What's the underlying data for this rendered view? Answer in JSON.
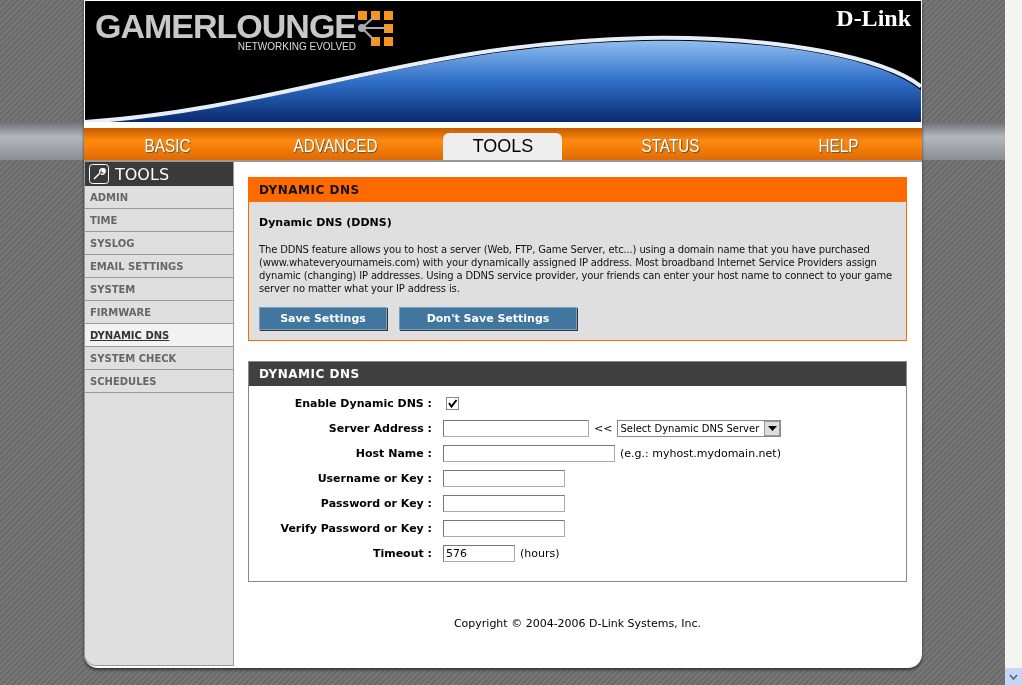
{
  "banner": {
    "logo_text": "GAMERLOUNGE",
    "logo_tagline": "NETWORKING EVOLVED",
    "brand": "D-Link"
  },
  "tabs": [
    {
      "label": "BASIC",
      "selected": false
    },
    {
      "label": "ADVANCED",
      "selected": false
    },
    {
      "label": "TOOLS",
      "selected": true
    },
    {
      "label": "STATUS",
      "selected": false
    },
    {
      "label": "HELP",
      "selected": false
    }
  ],
  "sidebar": {
    "title": "TOOLS",
    "items": [
      {
        "label": "ADMIN",
        "selected": false
      },
      {
        "label": "TIME",
        "selected": false
      },
      {
        "label": "SYSLOG",
        "selected": false
      },
      {
        "label": "EMAIL SETTINGS",
        "selected": false
      },
      {
        "label": "SYSTEM",
        "selected": false
      },
      {
        "label": "FIRMWARE",
        "selected": false
      },
      {
        "label": "DYNAMIC DNS",
        "selected": true
      },
      {
        "label": "SYSTEM CHECK",
        "selected": false
      },
      {
        "label": "SCHEDULES",
        "selected": false
      }
    ]
  },
  "intro": {
    "title": "DYNAMIC DNS",
    "subtitle": "Dynamic DNS (DDNS)",
    "text": "The DDNS feature allows you to host a server (Web, FTP, Game Server, etc...) using a domain name that you have purchased (www.whateveryournameis.com) with your dynamically assigned IP address. Most broadband Internet Service Providers assign dynamic (changing) IP addresses. Using a DDNS service provider, your friends can enter your host name to connect to your game server no matter what your IP address is.",
    "buttons": [
      "Save Settings",
      "Don't Save Settings"
    ]
  },
  "form": {
    "title": "DYNAMIC DNS",
    "rows": [
      {
        "kind": "checkbox",
        "label": "Enable Dynamic DNS :",
        "checked": true
      },
      {
        "kind": "server",
        "label": "Server Address :",
        "arrow": "<<",
        "select": "Select Dynamic DNS Server"
      },
      {
        "kind": "hinted",
        "label": "Host Name :",
        "hint": "(e.g.: myhost.mydomain.net)"
      },
      {
        "kind": "text",
        "label": "Username or Key :"
      },
      {
        "kind": "text",
        "label": "Password or Key :"
      },
      {
        "kind": "text",
        "label": "Verify Password or Key :"
      },
      {
        "kind": "unit",
        "label": "Timeout :",
        "value": "576",
        "unit": "(hours)"
      }
    ]
  },
  "copyright": "Copyright © 2004-2006 D-Link Systems, Inc."
}
